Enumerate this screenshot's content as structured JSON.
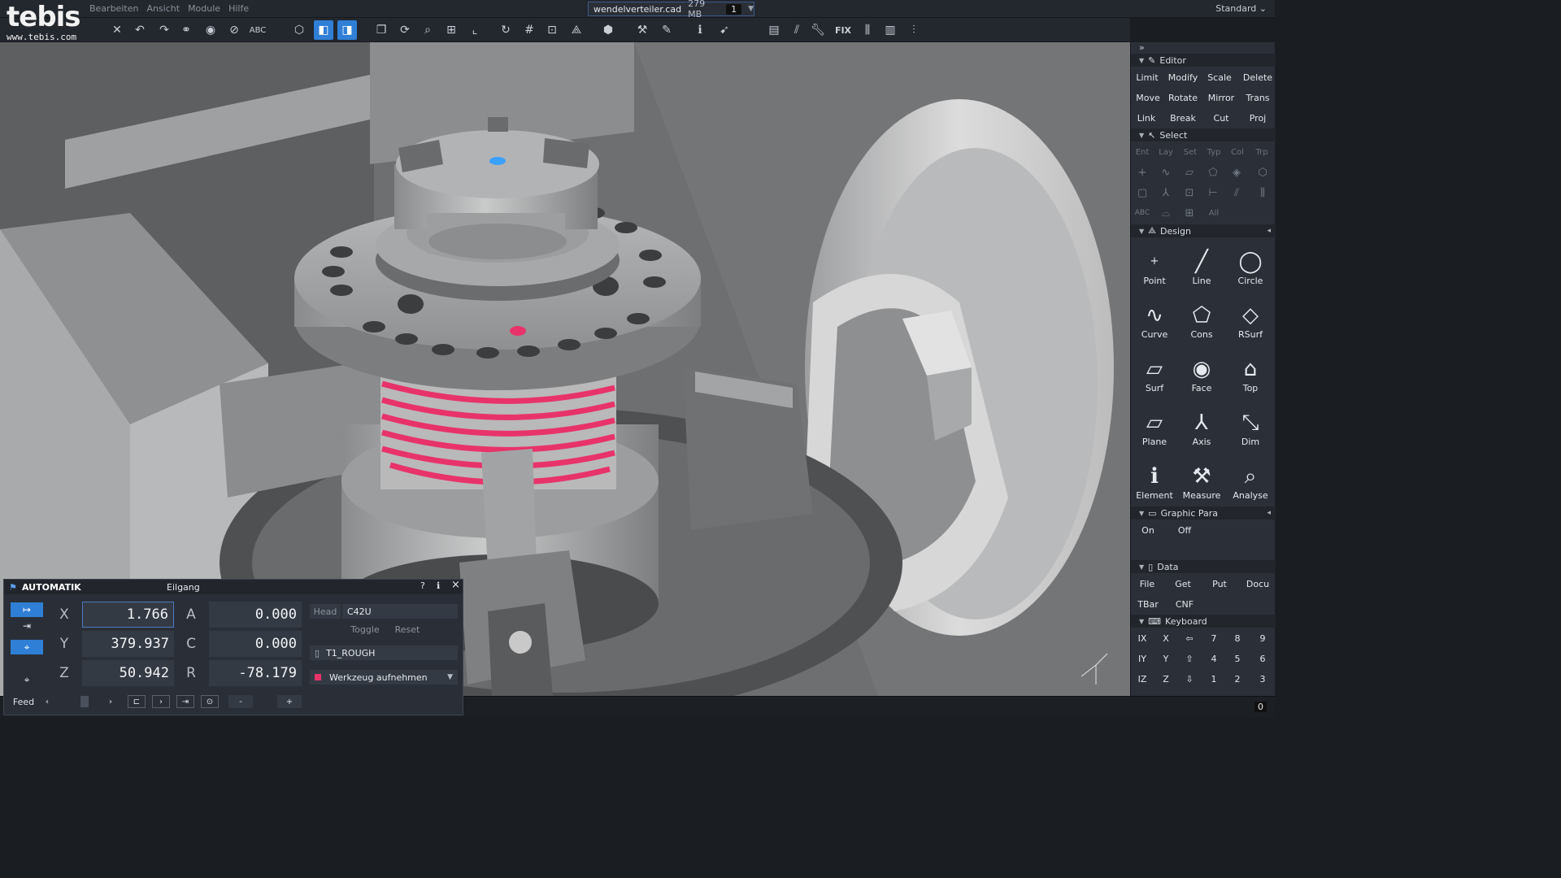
{
  "app": {
    "logo_text": "tebis",
    "logo_url": "www.tebis.com",
    "menus": [
      "Bearbeiten",
      "Ansicht",
      "Module",
      "Hilfe"
    ],
    "file": {
      "name": "wendelverteiler.cad",
      "size": "279 MB",
      "window_number": "1"
    },
    "profile": "Standard"
  },
  "toolbar": {
    "fix_label": "FIX"
  },
  "panel": {
    "editor": {
      "title": "Editor",
      "buttons": [
        "Limit",
        "Modify",
        "Scale",
        "Delete",
        "Move",
        "Rotate",
        "Mirror",
        "Trans",
        "Link",
        "Break",
        "Cut",
        "Proj"
      ]
    },
    "select": {
      "title": "Select",
      "filters": [
        "Ent",
        "Lay",
        "Set",
        "Typ",
        "Col",
        "Trp"
      ],
      "all_label": "All"
    },
    "design": {
      "title": "Design",
      "buttons": [
        "Point",
        "Line",
        "Circle",
        "Curve",
        "Cons",
        "RSurf",
        "Surf",
        "Face",
        "Top",
        "Plane",
        "Axis",
        "Dim",
        "Element",
        "Measure",
        "Analyse"
      ]
    },
    "graphic_para": {
      "title": "Graphic Para",
      "buttons": [
        "On",
        "Off"
      ]
    },
    "data": {
      "title": "Data",
      "buttons": [
        "File",
        "Get",
        "Put",
        "Docu",
        "TBar",
        "CNF"
      ]
    },
    "keyboard": {
      "title": "Keyboard",
      "rows": [
        [
          "IX",
          "X",
          "⇦",
          "7",
          "8",
          "9"
        ],
        [
          "IY",
          "Y",
          "⇧",
          "4",
          "5",
          "6"
        ],
        [
          "IZ",
          "Z",
          "⇩",
          "1",
          "2",
          "3"
        ]
      ]
    }
  },
  "automatik": {
    "title": "AUTOMATIK",
    "mode": "Eilgang",
    "help": "?",
    "close": "×",
    "axes": [
      {
        "label": "X",
        "value": "1.766"
      },
      {
        "label": "Y",
        "value": "379.937"
      },
      {
        "label": "Z",
        "value": "50.942"
      }
    ],
    "rot_axes": [
      {
        "label": "A",
        "value": "0.000"
      },
      {
        "label": "C",
        "value": "0.000"
      },
      {
        "label": "R",
        "value": "-78.179"
      }
    ],
    "head_label": "Head",
    "head_value": "C42U",
    "toggle_label": "Toggle",
    "reset_label": "Reset",
    "tool": "T1_ROUGH",
    "action": "Werkzeug aufnehmen",
    "feed_label": "Feed",
    "minus": "-",
    "plus": "+"
  },
  "status": {
    "count": "0"
  },
  "colors": {
    "accent": "#2f7fd6",
    "spring": "#e8336a",
    "viewport_bg": "#6e6f71"
  }
}
